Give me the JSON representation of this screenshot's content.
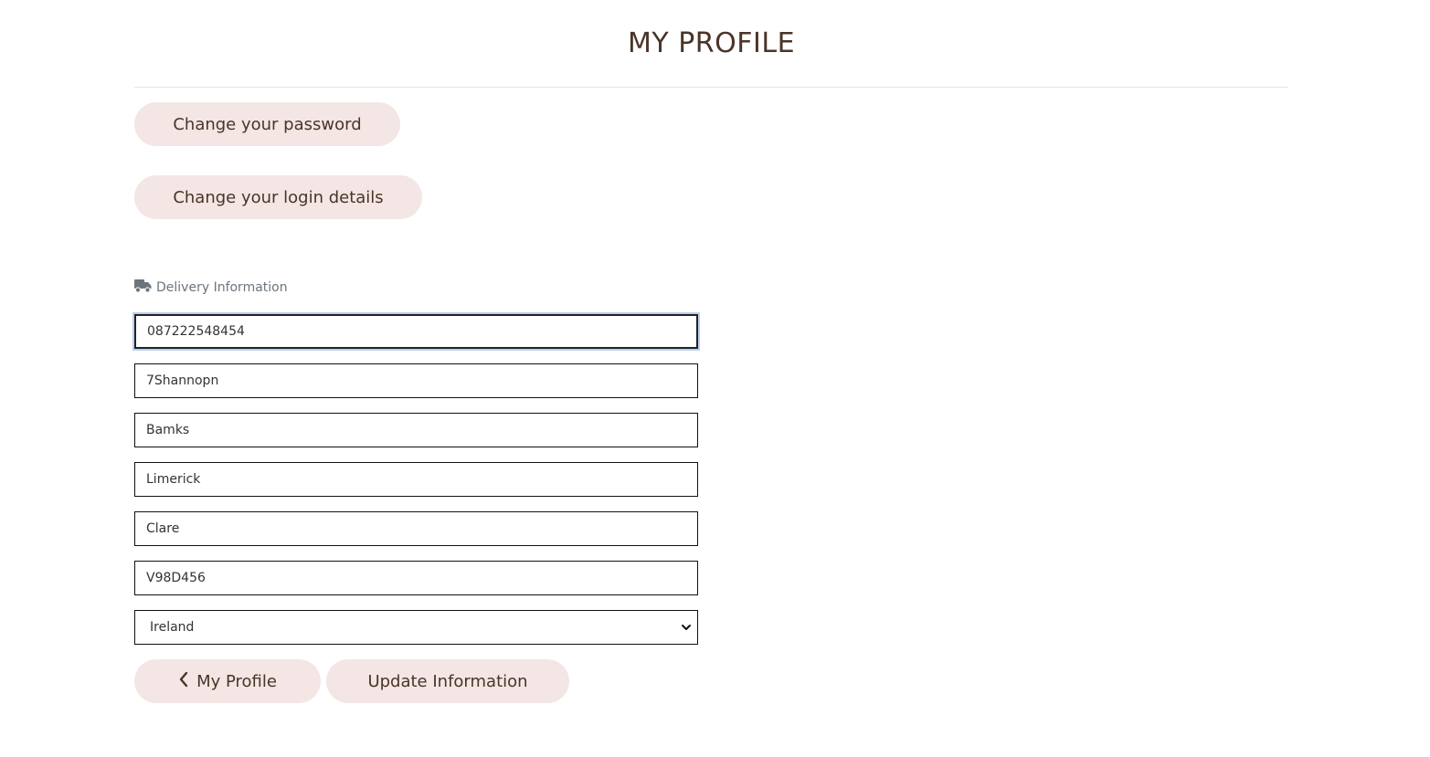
{
  "page": {
    "title": "MY PROFILE"
  },
  "actions": {
    "change_password": "Change your password",
    "change_login": "Change your login details"
  },
  "delivery": {
    "label": "Delivery Information",
    "icon": "truck-icon",
    "fields": {
      "phone": "087222548454",
      "address1": "7Shannopn",
      "address2": "Bamks",
      "city": "Limerick",
      "county": "Clare",
      "postcode": "V98D456",
      "country": "Ireland"
    }
  },
  "footer": {
    "back_label": "My Profile",
    "update_label": "Update Information"
  },
  "colors": {
    "text": "#4a3428",
    "button_bg": "#f3e6e4",
    "muted": "#6c757d"
  }
}
